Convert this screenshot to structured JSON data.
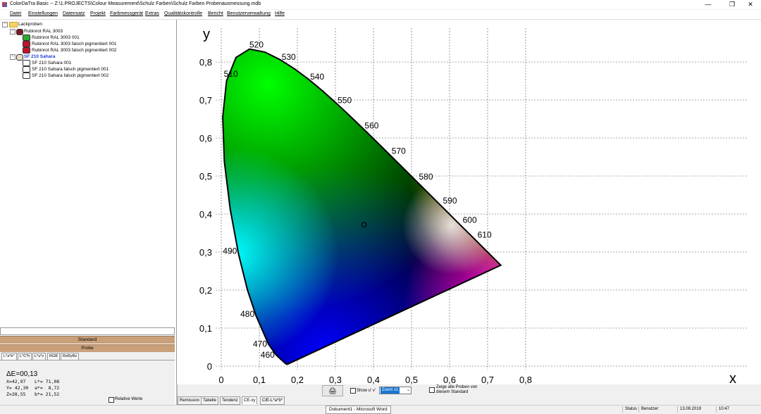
{
  "window": {
    "title": "ColorDaTra Basic --  Z:\\1.PROJECTS\\Colour Measurement\\Schulz Farben\\Schulz Farben Probenausmessung.mdb",
    "minimize": "—",
    "maximize": "❐",
    "close": "✕"
  },
  "menu": [
    "Datei",
    "Einstellungen",
    "Datensatz",
    "Projekt",
    "Farbmessgerät",
    "Extras",
    "Qualitätskontrolle",
    "Bericht",
    "Benutzerverwaltung",
    "Hilfe"
  ],
  "tree": {
    "root": "Lackproben",
    "groups": [
      {
        "label": "Rubinrot RAL 3003",
        "items": [
          {
            "label": "Rubinrot RAL 3003 001",
            "color": "#2faa2f"
          },
          {
            "label": "Rubinrot RAL 3003 falsch pigmentiert 001",
            "color": "#c0142c"
          },
          {
            "label": "Rubinrot RAL 3003 falsch pigmentiert 002",
            "color": "#c0142c"
          }
        ]
      },
      {
        "label": "SF 210 Sahara",
        "items": [
          {
            "label": "SF 210 Sahara  001",
            "color": "#ffffff"
          },
          {
            "label": "SF 210 Sahara falsch pigmentiert 001",
            "color": "#ffffff"
          },
          {
            "label": "SF 210 Sahara falsch pigmentiert 002",
            "color": "#ffffff"
          }
        ]
      }
    ]
  },
  "bars": {
    "standard": "Standard",
    "probe": "Probe"
  },
  "left_tabs": [
    "L*a*b*",
    "L*C*h",
    "L*u*v",
    "RGB",
    "RxRyRz"
  ],
  "values": {
    "delta": "ΔE=00,13",
    "x": "X=42,97",
    "y": "Y= 42,30",
    "z": "Z=28,55",
    "L": "L*= 71,08",
    "a": "a*=  8,72",
    "b": "b*= 21,52",
    "relative": "Relative Werte"
  },
  "controls": {
    "show_uv": "Show u' v'",
    "zoom": "Zoom x1",
    "zoom_arrow": "⌄",
    "show_all_line1": "Zeige alle Proben von",
    "show_all_line2": "diesem Standard",
    "printer_icon": "🖨"
  },
  "plot_tabs": [
    "Remission",
    "Tabelle",
    "Tendenz",
    "CE-xy",
    "CIE-L*a*b*"
  ],
  "taskbar": {
    "item": "Dokument1 - Microsoft Word"
  },
  "statusbar": {
    "status": "Status",
    "user": "Benutzer:",
    "date": "13.09.2019",
    "time": "10:47"
  },
  "chart_data": {
    "type": "scatter",
    "x_axis_label": "x",
    "y_axis_label": "y",
    "xlim": [
      0,
      0.8
    ],
    "ylim": [
      0,
      0.8
    ],
    "x_ticks": [
      "0",
      "0,1",
      "0,2",
      "0,3",
      "0,4",
      "0,5",
      "0,6",
      "0,7",
      "0,8"
    ],
    "y_ticks": [
      "0",
      "0,1",
      "0,2",
      "0,3",
      "0,4",
      "0,5",
      "0,6",
      "0,7",
      "0,8"
    ],
    "grid": true,
    "locus_wavelengths": [
      {
        "nm": "460",
        "x": 0.144,
        "y": 0.03
      },
      {
        "nm": "470",
        "x": 0.124,
        "y": 0.058
      },
      {
        "nm": "480",
        "x": 0.091,
        "y": 0.133
      },
      {
        "nm": "490",
        "x": 0.045,
        "y": 0.295
      },
      {
        "nm": "510",
        "x": 0.014,
        "y": 0.75
      },
      {
        "nm": "520",
        "x": 0.074,
        "y": 0.834
      },
      {
        "nm": "530",
        "x": 0.155,
        "y": 0.806
      },
      {
        "nm": "540",
        "x": 0.23,
        "y": 0.754
      },
      {
        "nm": "550",
        "x": 0.302,
        "y": 0.692
      },
      {
        "nm": "560",
        "x": 0.373,
        "y": 0.625
      },
      {
        "nm": "570",
        "x": 0.444,
        "y": 0.555
      },
      {
        "nm": "580",
        "x": 0.512,
        "y": 0.487
      },
      {
        "nm": "590",
        "x": 0.575,
        "y": 0.424
      },
      {
        "nm": "600",
        "x": 0.627,
        "y": 0.373
      },
      {
        "nm": "610",
        "x": 0.666,
        "y": 0.334
      }
    ],
    "sample_point": {
      "x": 0.375,
      "y": 0.372
    }
  }
}
